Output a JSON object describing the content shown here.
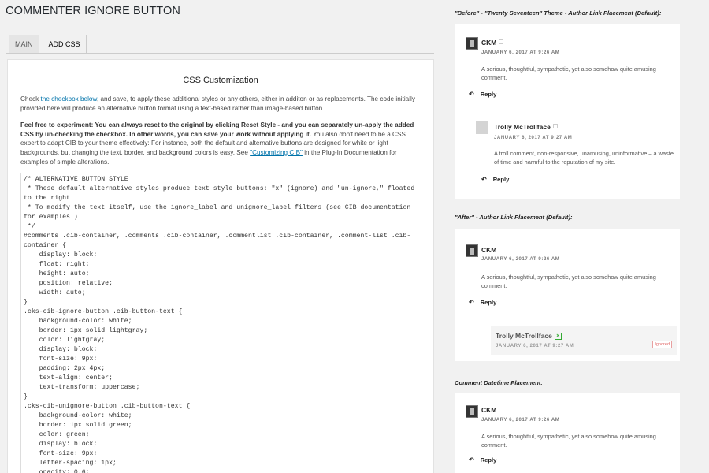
{
  "page": {
    "title": "COMMENTER IGNORE BUTTON"
  },
  "tabs": [
    {
      "label": "MAIN"
    },
    {
      "label": "ADD CSS"
    }
  ],
  "panel": {
    "title": "CSS Customization",
    "p1": {
      "pre": "Check ",
      "link": "the checkbox below",
      "post": ", and save, to apply these additional styles or any others, either in additon or as replacements. The code initially provided here will produce an alternative button format using a text-based rather than image-based button."
    },
    "p2": {
      "bold": "Feel free to experiment: You can always reset to the original by clicking Reset Style - and you can separately un-apply the added CSS by un-checking the checkbox. In other words, you can save your work without applying it.",
      "rest": " You also don't need to be a CSS expert to adapt CIB to your theme effectively: For instance, both the default and alternative buttons are designed for white or light backgrounds, but changing the text, border, and background colors is easy. See ",
      "link": "\"Customizing CIB\"",
      "post": " in the Plug-In Documentation for examples of simple alterations."
    },
    "code": "/* ALTERNATIVE BUTTON STYLE\n * These default alternative styles produce text style buttons: \"x\" (ignore) and \"un-ignore,\" floated to the right\n * To modify the text itself, use the ignore_label and unignore_label filters (see CIB documentation for examples.)\n */\n#comments .cib-container, .comments .cib-container, .commentlist .cib-container, .comment-list .cib-container {\n    display: block;\n    float: right;\n    height: auto;\n    position: relative;\n    width: auto;\n}\n.cks-cib-ignore-button .cib-button-text {\n    background-color: white;\n    border: 1px solid lightgray;\n    color: lightgray;\n    display: block;\n    font-size: 9px;\n    padding: 2px 4px;\n    text-align: center;\n    text-transform: uppercase;\n}\n.cks-cib-unignore-button .cib-button-text {\n    background-color: white;\n    border: 1px solid green;\n    color: green;\n    display: block;\n    font-size: 9px;\n    letter-spacing: 1px;\n    opacity: 0.6;"
  },
  "sidebar": {
    "before": {
      "heading": "\"Before\" - \"Twenty Seventeen\" Theme - Author Link Placement (Default):",
      "c1": {
        "author": "CKM",
        "date": "JANUARY 6, 2017 AT 9:26 AM",
        "text": "A serious, thoughtful, sympathetic, yet also somehow quite amusing comment.",
        "reply": "Reply"
      },
      "c2": {
        "author": "Trolly McTrollface",
        "date": "JANUARY 6, 2017 AT 9:27 AM",
        "text": "A troll comment, non-responsive, unamusing, uninformative – a waste of time and harmful to the reputation of my site.",
        "reply": "Reply"
      }
    },
    "after": {
      "heading": "\"After\" - Author Link Placement (Default):",
      "c1": {
        "author": "CKM",
        "date": "JANUARY 6, 2017 AT 9:26 AM",
        "text": "A serious, thoughtful, sympathetic, yet also somehow quite amusing comment.",
        "reply": "Reply"
      },
      "c2": {
        "author": "Trolly McTrollface",
        "date": "JANUARY 6, 2017 AT 9:27 AM",
        "badge": "Ignored"
      }
    },
    "datetime": {
      "heading": "Comment Datetime Placement:",
      "c1": {
        "author": "CKM",
        "date": "JANUARY 6, 2017 AT 9:26 AM",
        "text": "A serious, thoughtful, sympathetic, yet also somehow quite amusing comment.",
        "reply": "Reply"
      }
    }
  }
}
